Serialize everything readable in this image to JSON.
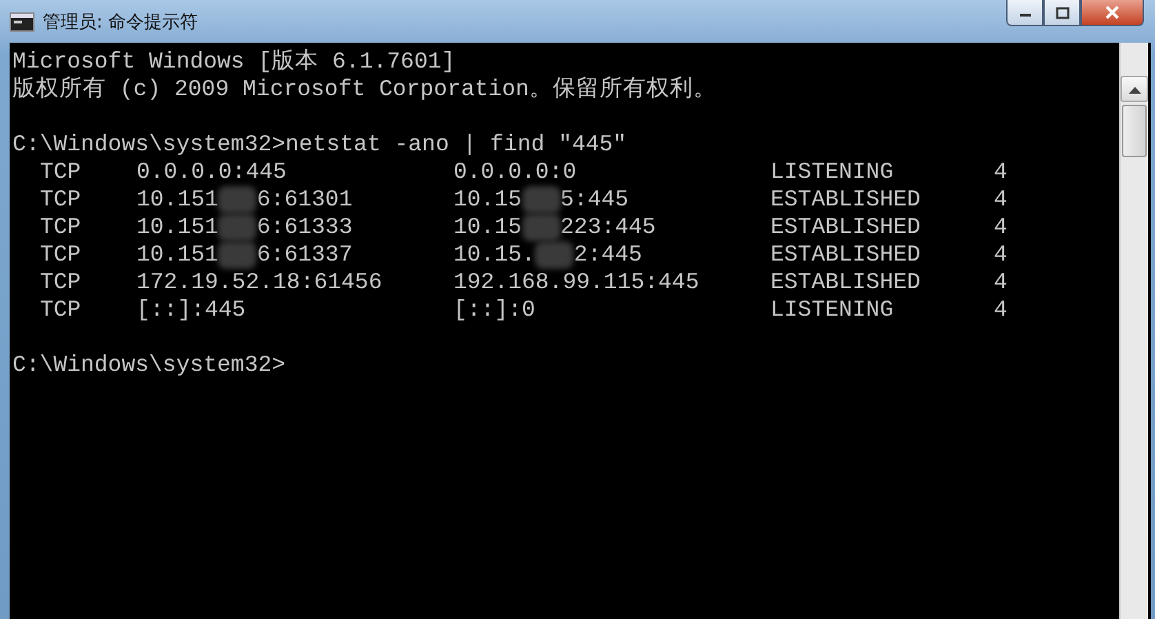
{
  "window": {
    "title": "管理员: 命令提示符"
  },
  "console": {
    "header_lines": [
      "Microsoft Windows [版本 6.1.7601]",
      "版权所有 (c) 2009 Microsoft Corporation。保留所有权利。"
    ],
    "command": "C:\\Windows\\system32>netstat -ano | find \"445\"",
    "rows": [
      {
        "protocol": "TCP",
        "local": [
          "0.0.0.0:445"
        ],
        "foreign": [
          "0.0.0.0:0"
        ],
        "state": "LISTENING",
        "pid": "4"
      },
      {
        "protocol": "TCP",
        "local": [
          "10.151",
          "6:61301"
        ],
        "foreign": [
          "10.15",
          "5:445"
        ],
        "state": "ESTABLISHED",
        "pid": "4"
      },
      {
        "protocol": "TCP",
        "local": [
          "10.151",
          "6:61333"
        ],
        "foreign": [
          "10.15",
          "223:445"
        ],
        "state": "ESTABLISHED",
        "pid": "4"
      },
      {
        "protocol": "TCP",
        "local": [
          "10.151",
          "6:61337"
        ],
        "foreign": [
          "10.15.",
          "2:445"
        ],
        "state": "ESTABLISHED",
        "pid": "4"
      },
      {
        "protocol": "TCP",
        "local": [
          "172.19.52.18:61456"
        ],
        "foreign": [
          "192.168.99.115:445"
        ],
        "state": "ESTABLISHED",
        "pid": "4"
      },
      {
        "protocol": "TCP",
        "local": [
          "[::]:445"
        ],
        "foreign": [
          "[::]:0"
        ],
        "state": "LISTENING",
        "pid": "4"
      }
    ],
    "prompt": "C:\\Windows\\system32>"
  }
}
